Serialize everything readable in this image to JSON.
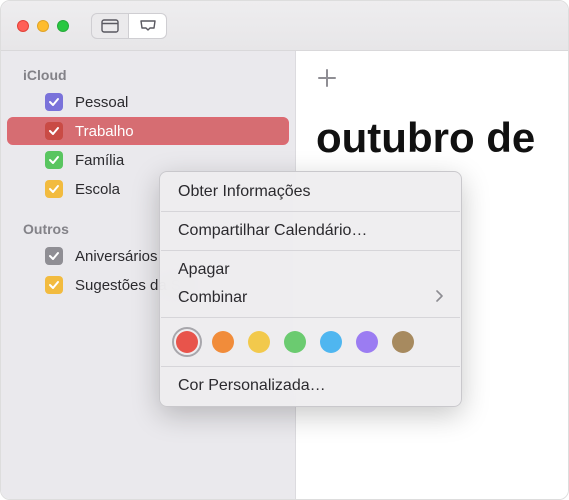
{
  "sidebar": {
    "sections": [
      {
        "title": "iCloud",
        "items": [
          {
            "label": "Pessoal",
            "color": "#7a72da"
          },
          {
            "label": "Trabalho",
            "color": "#e8544b",
            "selected": true
          },
          {
            "label": "Família",
            "color": "#59c560"
          },
          {
            "label": "Escola",
            "color": "#f2bb3f"
          }
        ]
      },
      {
        "title": "Outros",
        "items": [
          {
            "label": "Aniversários",
            "color": "#8f8e94"
          },
          {
            "label": "Sugestões da Siri",
            "color": "#f2bb3f"
          }
        ]
      }
    ]
  },
  "main": {
    "title": "outubro de"
  },
  "context_menu": {
    "get_info": "Obter Informações",
    "share": "Compartilhar Calendário…",
    "delete": "Apagar",
    "merge": "Combinar",
    "custom_color": "Cor Personalizada…",
    "colors": [
      {
        "hex": "#e8544b",
        "selected": true
      },
      {
        "hex": "#f18c3a"
      },
      {
        "hex": "#f2c94c"
      },
      {
        "hex": "#6bcb70"
      },
      {
        "hex": "#4fb6f0"
      },
      {
        "hex": "#9b7cf2"
      },
      {
        "hex": "#a78a5f"
      }
    ]
  }
}
